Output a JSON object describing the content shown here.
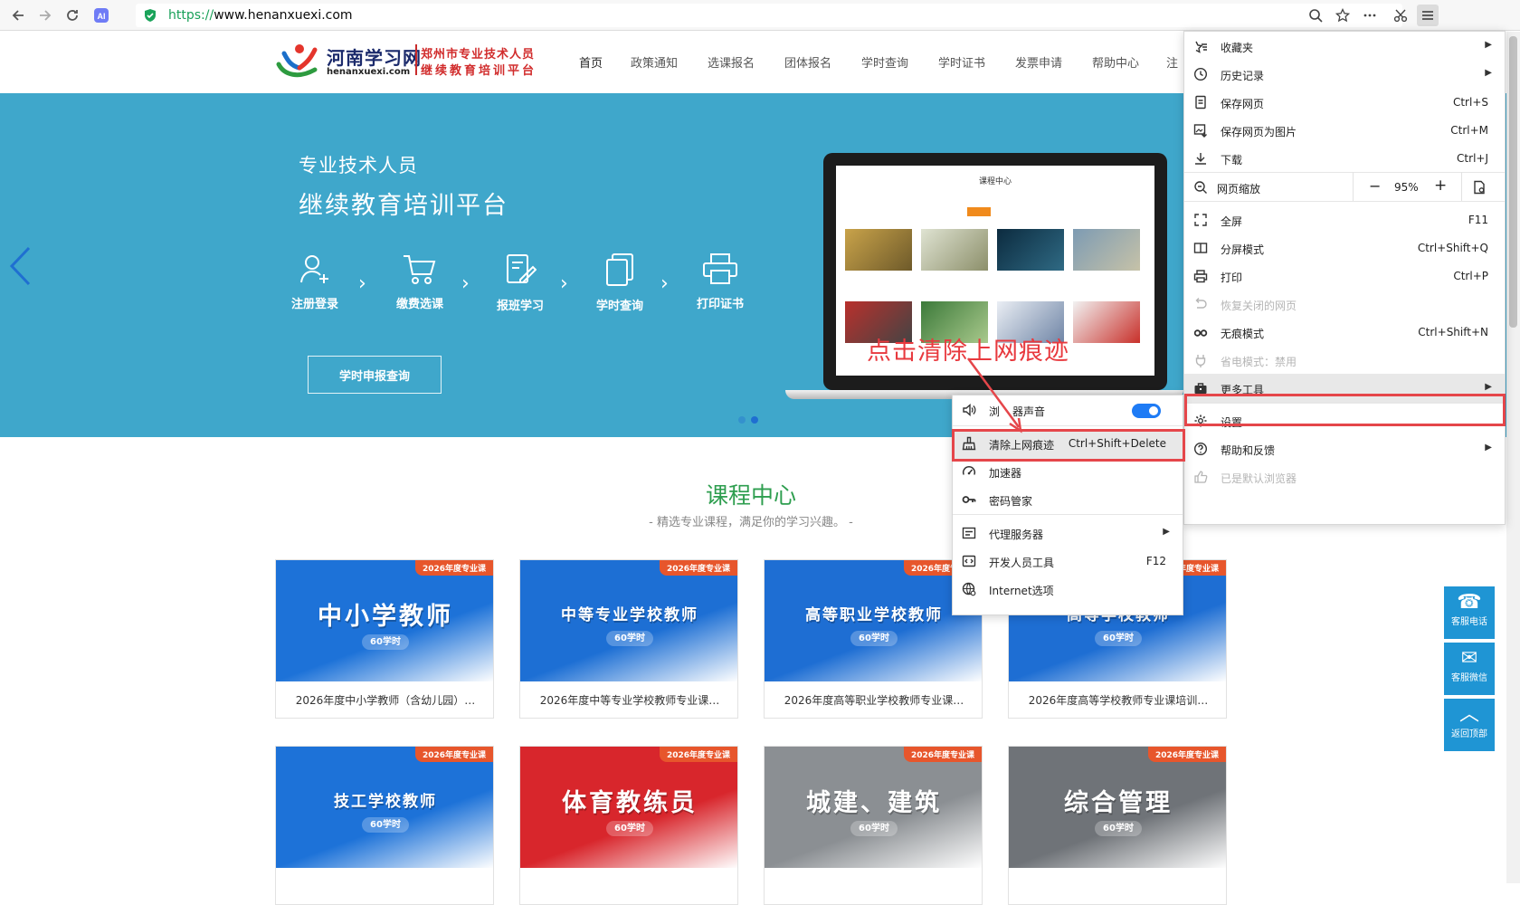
{
  "browser": {
    "url_protocol": "https://",
    "url_rest": "www.henanxuexi.com"
  },
  "site": {
    "logo_name": "河南学习网",
    "logo_domain": "henanxuexi.com",
    "logo_tag1": "郑州市专业技术人员",
    "logo_tag2": "继续教育培训平台",
    "nav": [
      "首页",
      "政策通知",
      "选课报名",
      "团体报名",
      "学时查询",
      "学时证书",
      "发票申请",
      "帮助中心",
      "注"
    ]
  },
  "banner": {
    "line1": "专业技术人员",
    "line2": "继续教育培训平台",
    "steps": [
      "注册登录",
      "缴费选课",
      "报班学习",
      "学时查询",
      "打印证书"
    ],
    "query_button": "学时申报查询",
    "laptop_title": "课程中心"
  },
  "courses": {
    "title": "课程中心",
    "subtitle": "- 精选专业课程，满足你的学习兴趣。 -",
    "ribbon": "2026年度专业课",
    "hours": "60学时",
    "cards": [
      {
        "big": "中小学教师",
        "title": "2026年度中小学教师（含幼儿园）…",
        "color": "#1d72d8"
      },
      {
        "big": "中等专业学校教师",
        "title": "2026年度中等专业学校教师专业课…",
        "color": "#1d6fd4"
      },
      {
        "big": "高等职业学校教师",
        "title": "2026年度高等职业学校教师专业课…",
        "color": "#1e6ed3"
      },
      {
        "big": "高等学校教师",
        "title": "2026年度高等学校教师专业课培训…",
        "color": "#1e6ed3"
      },
      {
        "big": "技工学校教师",
        "title": "",
        "color": "#1d72d8"
      },
      {
        "big": "体育教练员",
        "title": "",
        "color": "#d8262c"
      },
      {
        "big": "城建、建筑",
        "title": "",
        "color": "#8b8f93"
      },
      {
        "big": "综合管理",
        "title": "",
        "color": "#6f7378"
      }
    ]
  },
  "float_buttons": [
    "客服电话",
    "客服微信",
    "返回顶部"
  ],
  "main_menu": {
    "items": [
      {
        "label": "收藏夹",
        "shortcut": "",
        "submenu": true
      },
      {
        "label": "历史记录",
        "shortcut": "",
        "submenu": true
      },
      {
        "label": "保存网页",
        "shortcut": "Ctrl+S"
      },
      {
        "label": "保存网页为图片",
        "shortcut": "Ctrl+M"
      },
      {
        "label": "下载",
        "shortcut": "Ctrl+J"
      },
      {
        "label": "全屏",
        "shortcut": "F11"
      },
      {
        "label": "分屏模式",
        "shortcut": "Ctrl+Shift+Q"
      },
      {
        "label": "打印",
        "shortcut": "Ctrl+P"
      },
      {
        "label": "恢复关闭的网页",
        "shortcut": ""
      },
      {
        "label": "无痕模式",
        "shortcut": "Ctrl+Shift+N"
      },
      {
        "label": "省电模式：禁用",
        "shortcut": ""
      },
      {
        "label": "更多工具",
        "shortcut": "",
        "submenu": true
      },
      {
        "label": "设置",
        "shortcut": ""
      },
      {
        "label": "帮助和反馈",
        "shortcut": "",
        "submenu": true
      },
      {
        "label": "已是默认浏览器",
        "shortcut": ""
      }
    ],
    "zoom_label": "网页缩放",
    "zoom_minus": "−",
    "zoom_value": "95%",
    "zoom_plus": "+"
  },
  "tools_menu": {
    "sound_label_a": "浏",
    "sound_label_b": "器声音",
    "items": [
      {
        "label": "清除上网痕迹",
        "shortcut": "Ctrl+Shift+Delete"
      },
      {
        "label": "加速器",
        "shortcut": ""
      },
      {
        "label": "密码管家",
        "shortcut": ""
      },
      {
        "label": "代理服务器",
        "shortcut": "",
        "submenu": true
      },
      {
        "label": "开发人员工具",
        "shortcut": "F12"
      },
      {
        "label": "Internet选项",
        "shortcut": ""
      }
    ]
  },
  "annotation": "点击清除上网痕迹",
  "colors": {
    "banner": "#3fa7cb",
    "accent_green": "#2e9e4f",
    "highlight_red": "#e5464a",
    "float_blue": "#1f95d4"
  }
}
